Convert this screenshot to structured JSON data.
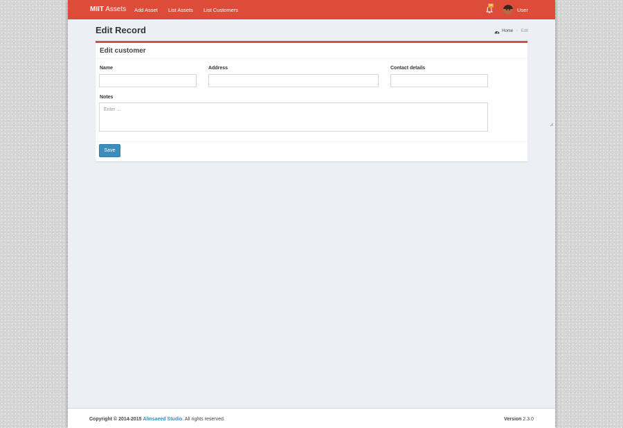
{
  "navbar": {
    "brand_bold": "MIIT",
    "brand_light": "Assets",
    "links": [
      "Add Asset",
      "List Assets",
      "List Customers"
    ],
    "notifications_count": "10",
    "user_name": "User",
    "bar_color": "#dd4b39"
  },
  "content_header": {
    "title": "Edit Record",
    "breadcrumb_home": "Home",
    "breadcrumb_current": "Edit"
  },
  "form": {
    "box_title": "Edit customer",
    "name_label": "Name",
    "name_value": "",
    "address_label": "Address",
    "address_value": "",
    "contact_label": "Contact details",
    "contact_value": "",
    "notes_label": "Notes",
    "notes_placeholder": "Enter ...",
    "save_label": "Save",
    "save_color": "#3c8dbc"
  },
  "footer": {
    "copyright_prefix": "Copyright © 2014-2015",
    "company": "Almsaeed Studio",
    "rights": ". All rights reserved.",
    "version_label": "Version",
    "version_value": "2.3.0"
  },
  "icons": [
    "bell-icon",
    "user-avatar",
    "dashboard-icon",
    "resize-grip-icon"
  ]
}
